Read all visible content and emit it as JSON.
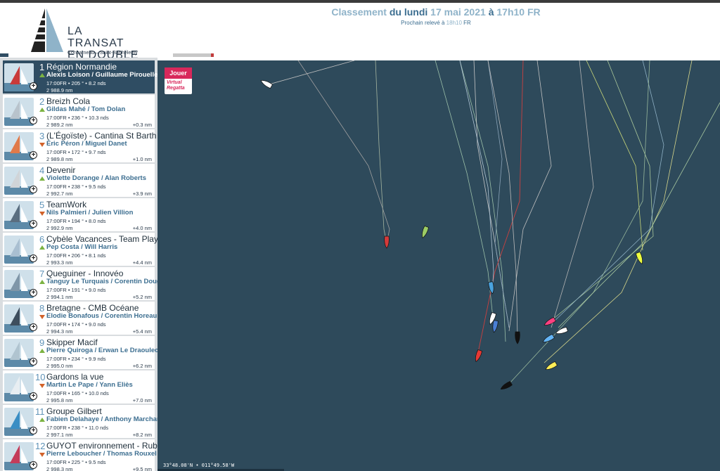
{
  "header": {
    "logo_line1": "LA TRANSAT",
    "logo_line2": "EN DOUBLE",
    "logo_sub": "Concarneau – Saint-Barthélemy",
    "ranking_prefix": "Classement",
    "ranking_day": "du lundi",
    "ranking_date": "17 mai 2021",
    "ranking_at": "à",
    "ranking_time": "17h10 FR",
    "next_label": "Prochain relevé à",
    "next_time": "18h10",
    "next_tz": "FR"
  },
  "map": {
    "play_label": "Jouer",
    "vr_line1": "Virtual",
    "vr_line2": "Regatta",
    "coords": "33°48.08'N • 011°49.58'W"
  },
  "colors": {
    "accent_light": "#8fb3c9",
    "accent_dark": "#3c6e90",
    "sidebar_selected": "#2f4d63",
    "map_sea": "#2e4a5b",
    "trend_up": "#7cb342",
    "trend_down": "#d1622a"
  },
  "ranking": [
    {
      "rank": "1",
      "boat": "Région Normandie",
      "trend": "up",
      "skippers": "Alexis Loison / Guillaume Pirouelle",
      "stats": "17:00FR • 205 ° • 8.2 nds",
      "dist": "2 988.9 nm",
      "gap": "",
      "selected": true
    },
    {
      "rank": "2",
      "boat": "Breizh Cola",
      "trend": "up",
      "skippers": "Gildas Mahé / Tom Dolan",
      "stats": "17:00FR • 236 ° • 10.3 nds",
      "dist": "2 989.2 nm",
      "gap": "+0.3 nm"
    },
    {
      "rank": "3",
      "boat": "(L'Égoïste) - Cantina St Barth",
      "trend": "down",
      "skippers": "Éric Péron / Miguel Danet",
      "stats": "17:00FR • 172 ° • 9.7 nds",
      "dist": "2 989.8 nm",
      "gap": "+1.0 nm"
    },
    {
      "rank": "4",
      "boat": "Devenir",
      "trend": "up",
      "skippers": "Violette Dorange / Alan Roberts",
      "stats": "17:00FR • 238 ° • 9.5 nds",
      "dist": "2 992.7 nm",
      "gap": "+3.9 nm"
    },
    {
      "rank": "5",
      "boat": "TeamWork",
      "trend": "down",
      "skippers": "Nils Palmieri / Julien Villion",
      "stats": "17:00FR • 194 ° • 8.0 nds",
      "dist": "2 992.9 nm",
      "gap": "+4.0 nm"
    },
    {
      "rank": "6",
      "boat": "Cybèle Vacances - Team Play to B",
      "trend": "up",
      "skippers": "Pep Costa / Will Harris",
      "stats": "17:00FR • 206 ° • 8.1 nds",
      "dist": "2 993.3 nm",
      "gap": "+4.4 nm"
    },
    {
      "rank": "7",
      "boat": "Queguiner - Innovéo",
      "trend": "up",
      "skippers": "Tanguy Le Turquais / Corentin Douguet",
      "stats": "17:00FR • 191 ° • 9.0 nds",
      "dist": "2 994.1 nm",
      "gap": "+5.2 nm"
    },
    {
      "rank": "8",
      "boat": "Bretagne - CMB Océane",
      "trend": "down",
      "skippers": "Elodie Bonafous / Corentin Horeau",
      "stats": "17:00FR • 174 ° • 9.0 nds",
      "dist": "2 994.3 nm",
      "gap": "+5.4 nm"
    },
    {
      "rank": "9",
      "boat": "Skipper Macif",
      "trend": "up",
      "skippers": "Pierre Quiroga / Erwan Le Draoulec",
      "stats": "17:00FR • 234 ° • 9.9 nds",
      "dist": "2 995.0 nm",
      "gap": "+6.2 nm"
    },
    {
      "rank": "10",
      "boat": "Gardons la vue",
      "trend": "down",
      "skippers": "Martin Le Pape / Yann Eliès",
      "stats": "17:00FR • 165 ° • 10.0 nds",
      "dist": "2 995.8 nm",
      "gap": "+7.0 nm"
    },
    {
      "rank": "11",
      "boat": "Groupe Gilbert",
      "trend": "up",
      "skippers": "Fabien Delahaye / Anthony Marchand",
      "stats": "17:00FR • 238 ° • 11.0 nds",
      "dist": "2 997.1 nm",
      "gap": "+8.2 nm"
    },
    {
      "rank": "12",
      "boat": "GUYOT environnement - Ruban Rose",
      "trend": "down",
      "skippers": "Pierre Leboucher / Thomas Rouxel",
      "stats": "17:00FR • 225 ° • 9.5 nds",
      "dist": "2 998.3 nm",
      "gap": "+9.5 nm"
    }
  ]
}
